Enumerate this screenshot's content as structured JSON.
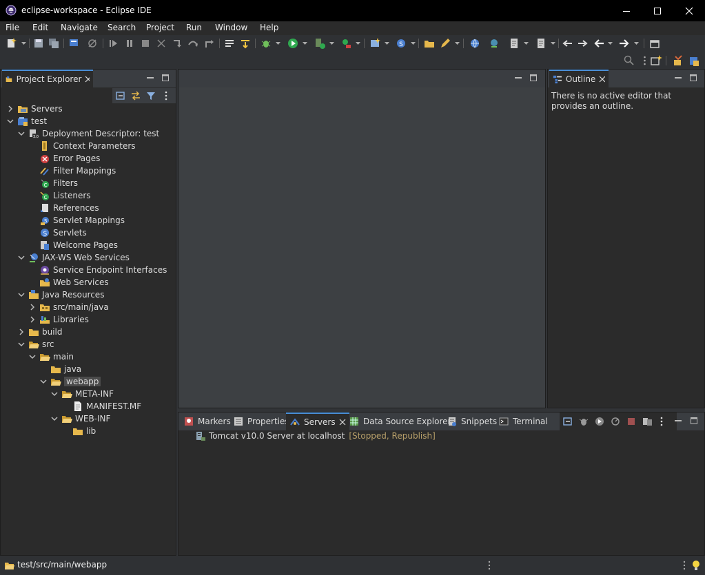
{
  "window": {
    "title": "eclipse-workspace - Eclipse IDE"
  },
  "menu": [
    "File",
    "Edit",
    "Navigate",
    "Search",
    "Project",
    "Run",
    "Window",
    "Help"
  ],
  "project_explorer": {
    "tab_label": "Project Explorer",
    "tree": [
      {
        "label": "Servers"
      },
      {
        "label": "test"
      },
      {
        "label": "Deployment Descriptor: test"
      },
      {
        "label": "Context Parameters"
      },
      {
        "label": "Error Pages"
      },
      {
        "label": "Filter Mappings"
      },
      {
        "label": "Filters"
      },
      {
        "label": "Listeners"
      },
      {
        "label": "References"
      },
      {
        "label": "Servlet Mappings"
      },
      {
        "label": "Servlets"
      },
      {
        "label": "Welcome Pages"
      },
      {
        "label": "JAX-WS Web Services"
      },
      {
        "label": "Service Endpoint Interfaces"
      },
      {
        "label": "Web Services"
      },
      {
        "label": "Java Resources"
      },
      {
        "label": "src/main/java"
      },
      {
        "label": "Libraries"
      },
      {
        "label": "build"
      },
      {
        "label": "src"
      },
      {
        "label": "main"
      },
      {
        "label": "java"
      },
      {
        "label": "webapp"
      },
      {
        "label": "META-INF"
      },
      {
        "label": "MANIFEST.MF"
      },
      {
        "label": "WEB-INF"
      },
      {
        "label": "lib"
      }
    ]
  },
  "outline": {
    "tab_label": "Outline",
    "message": "There is no active editor that provides an outline."
  },
  "bottom_panel": {
    "tabs": [
      "Markers",
      "Properties",
      "Servers",
      "Data Source Explorer",
      "Snippets",
      "Terminal"
    ],
    "server_name": "Tomcat v10.0 Server at localhost",
    "server_status": "[Stopped, Republish]"
  },
  "statusbar": {
    "path": "test/src/main/webapp"
  },
  "colors": {
    "accent": "#4a90d9",
    "status_text": "#b8a06a",
    "folder": "#e6b84c"
  }
}
